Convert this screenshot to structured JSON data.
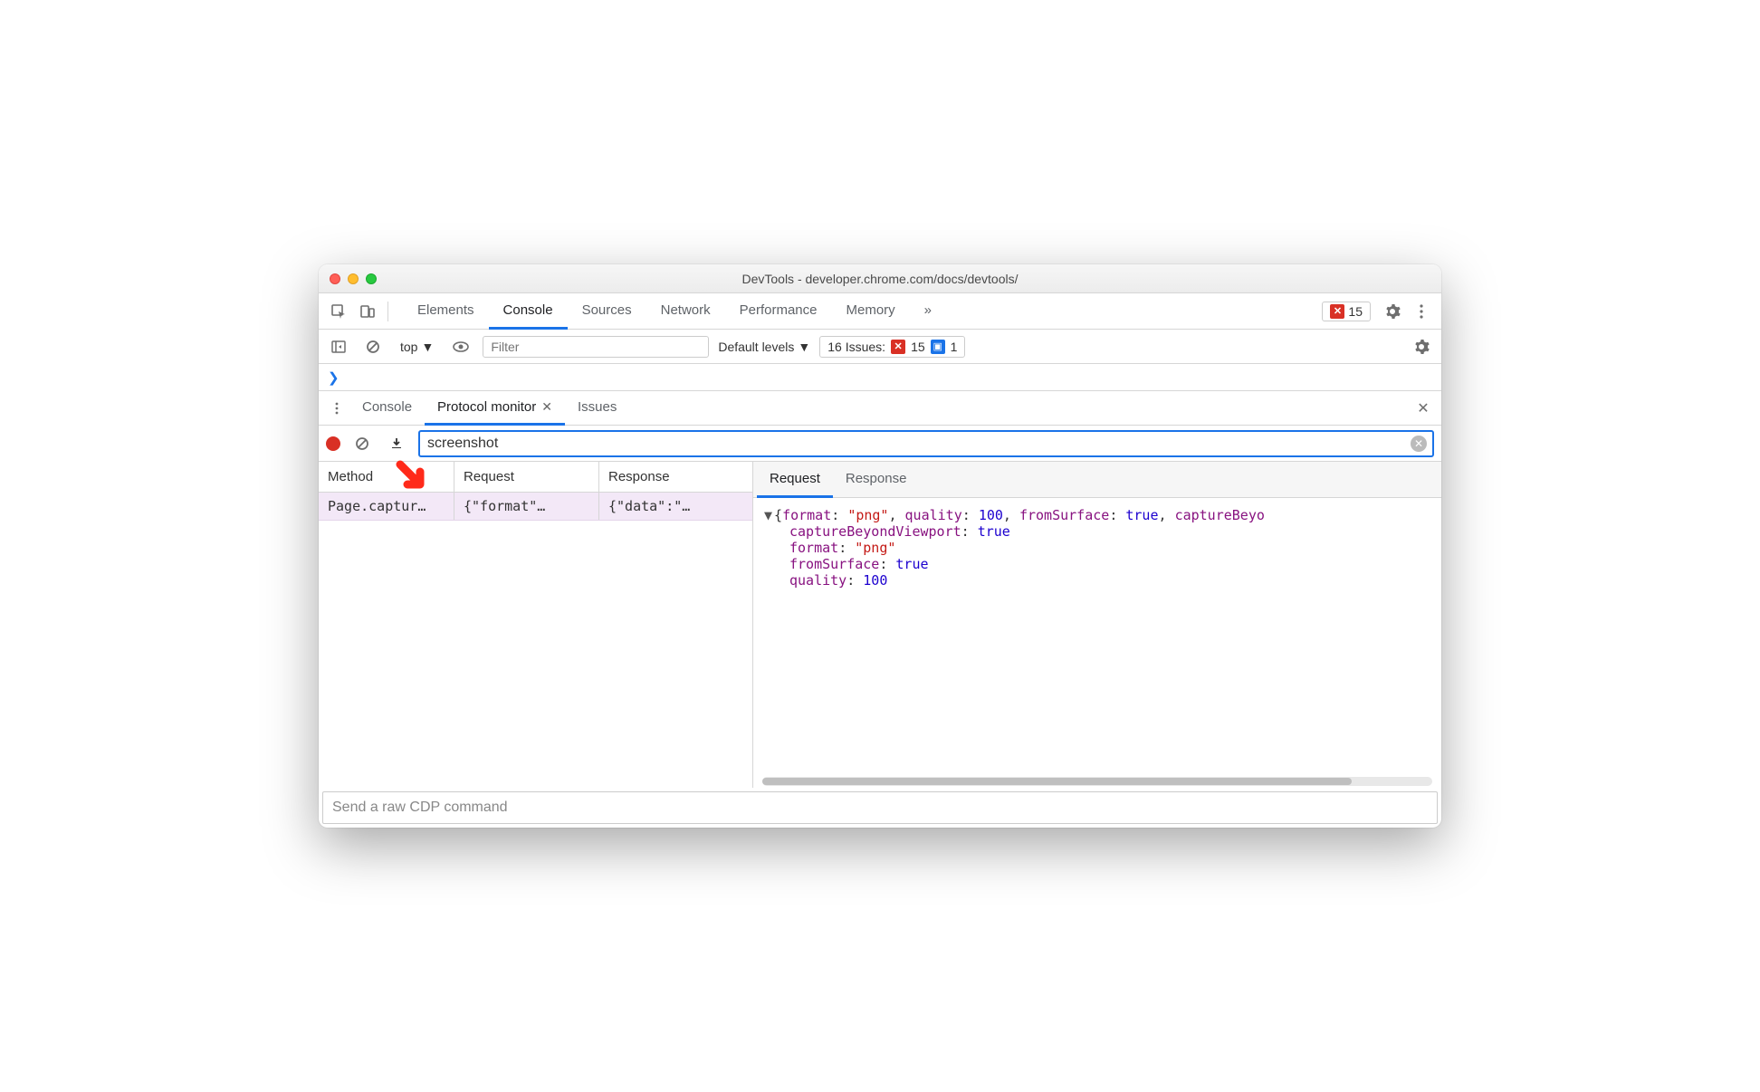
{
  "window": {
    "title": "DevTools - developer.chrome.com/docs/devtools/"
  },
  "mainTabs": {
    "elements": "Elements",
    "console": "Console",
    "sources": "Sources",
    "network": "Network",
    "performance": "Performance",
    "memory": "Memory",
    "active": "Console"
  },
  "errorBadge": {
    "count": "15"
  },
  "consoleBar": {
    "context": "top",
    "filterPlaceholder": "Filter",
    "levels": "Default levels",
    "issues": {
      "label": "16 Issues:",
      "errors": "15",
      "info": "1"
    }
  },
  "prompt": "❯",
  "drawer": {
    "tabs": {
      "console": "Console",
      "protocol": "Protocol monitor",
      "issues": "Issues"
    },
    "active": "Protocol monitor"
  },
  "pm": {
    "filterValue": "screenshot",
    "headers": {
      "method": "Method",
      "request": "Request",
      "response": "Response"
    },
    "row": {
      "method": "Page.captur…",
      "request": "{\"format\"…",
      "response": "{\"data\":\"…"
    },
    "detailTabs": {
      "request": "Request",
      "response": "Response",
      "active": "Request"
    },
    "detail": {
      "summary": "{format: \"png\", quality: 100, fromSurface: true, captureBeyo",
      "lines": [
        {
          "k": "captureBeyondViewport",
          "type": "bool",
          "v": "true"
        },
        {
          "k": "format",
          "type": "str",
          "v": "\"png\""
        },
        {
          "k": "fromSurface",
          "type": "bool",
          "v": "true"
        },
        {
          "k": "quality",
          "type": "num",
          "v": "100"
        }
      ]
    },
    "cdpPlaceholder": "Send a raw CDP command"
  }
}
